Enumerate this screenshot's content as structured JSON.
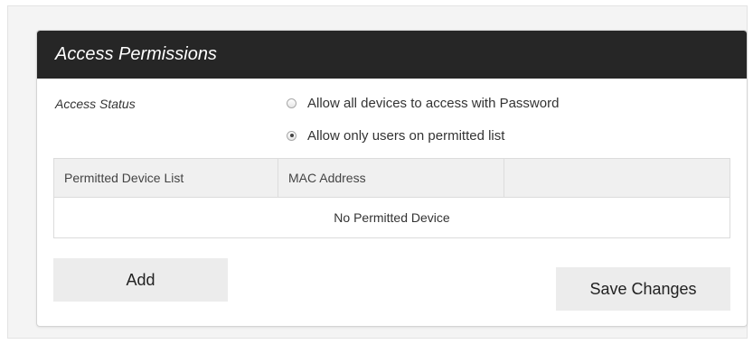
{
  "panel": {
    "title": "Access Permissions"
  },
  "access_status": {
    "label": "Access Status",
    "options": [
      {
        "label": "Allow all devices to access with Password",
        "selected": false
      },
      {
        "label": "Allow only users on permitted list",
        "selected": true
      }
    ]
  },
  "device_table": {
    "headers": [
      "Permitted Device List",
      "MAC Address",
      ""
    ],
    "empty_message": "No Permitted Device"
  },
  "buttons": {
    "add_label": "Add",
    "save_label": "Save Changes"
  },
  "colors": {
    "header_background": "#262626",
    "button_background": "#ececec",
    "page_background": "#f4f4f4"
  }
}
